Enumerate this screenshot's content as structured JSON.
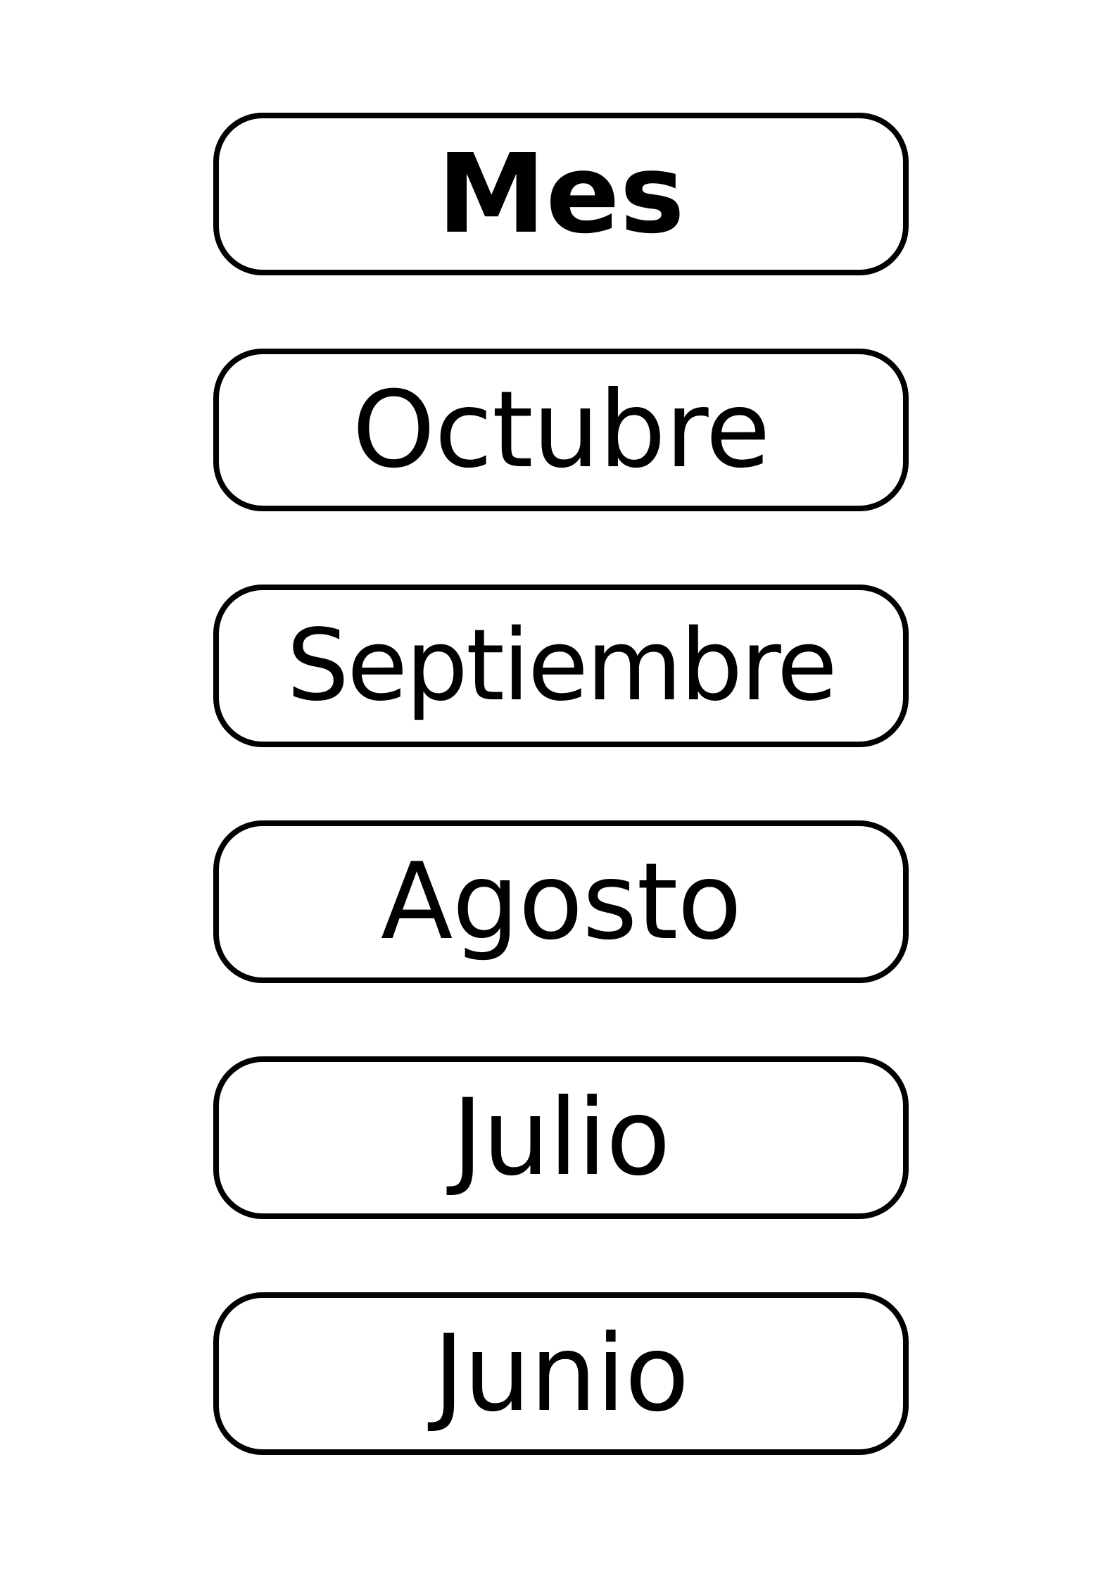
{
  "header": {
    "label": "Mes"
  },
  "months": [
    {
      "label": "Octubre"
    },
    {
      "label": "Septiembre"
    },
    {
      "label": "Agosto"
    },
    {
      "label": "Julio"
    },
    {
      "label": "Junio"
    }
  ],
  "colors": {
    "border": "#000000",
    "text": "#000000",
    "background": "#ffffff"
  }
}
